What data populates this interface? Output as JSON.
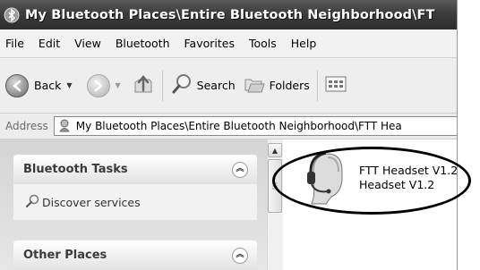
{
  "window": {
    "title": "My Bluetooth Places\\Entire Bluetooth Neighborhood\\FT"
  },
  "menu": {
    "items": [
      {
        "label": "File"
      },
      {
        "label": "Edit"
      },
      {
        "label": "View"
      },
      {
        "label": "Bluetooth"
      },
      {
        "label": "Favorites"
      },
      {
        "label": "Tools"
      },
      {
        "label": "Help"
      }
    ]
  },
  "toolbar": {
    "back_label": "Back",
    "search_label": "Search",
    "folders_label": "Folders"
  },
  "address": {
    "label": "Address",
    "value": "My Bluetooth Places\\Entire Bluetooth Neighborhood\\FTT Hea"
  },
  "tasks": {
    "bluetooth_tasks_title": "Bluetooth Tasks",
    "discover_services_label": "Discover services",
    "other_places_title": "Other Places"
  },
  "content": {
    "device_name": "FTT Headset V1.2",
    "device_type": "Headset V1.2"
  }
}
